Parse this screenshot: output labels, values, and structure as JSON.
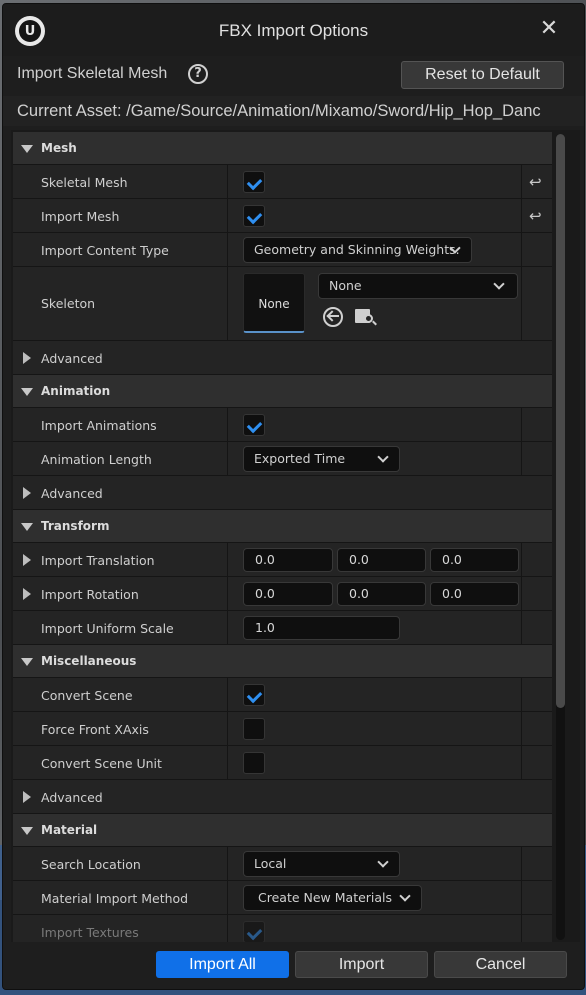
{
  "window": {
    "title": "FBX Import Options"
  },
  "header": {
    "title": "Import Skeletal Mesh",
    "help_icon": "?",
    "reset_label": "Reset to Default"
  },
  "asset": {
    "text": "Current Asset:  /Game/Source/Animation/Mixamo/Sword/Hip_Hop_Danc"
  },
  "sections": {
    "mesh": {
      "label": "Mesh",
      "skeletal_mesh": {
        "label": "Skeletal Mesh",
        "checked": true
      },
      "import_mesh": {
        "label": "Import Mesh",
        "checked": true
      },
      "import_content_type": {
        "label": "Import Content Type",
        "value": "Geometry and Skinning Weights."
      },
      "skeleton": {
        "label": "Skeleton",
        "thumb": "None",
        "value": "None"
      },
      "advanced": "Advanced"
    },
    "animation": {
      "label": "Animation",
      "import_animations": {
        "label": "Import Animations",
        "checked": true
      },
      "animation_length": {
        "label": "Animation Length",
        "value": "Exported Time"
      },
      "advanced": "Advanced"
    },
    "transform": {
      "label": "Transform",
      "import_translation": {
        "label": "Import Translation",
        "x": "0.0",
        "y": "0.0",
        "z": "0.0"
      },
      "import_rotation": {
        "label": "Import Rotation",
        "x": "0.0",
        "y": "0.0",
        "z": "0.0"
      },
      "import_uniform_scale": {
        "label": "Import Uniform Scale",
        "value": "1.0"
      }
    },
    "miscellaneous": {
      "label": "Miscellaneous",
      "convert_scene": {
        "label": "Convert Scene",
        "checked": true
      },
      "force_front_xaxis": {
        "label": "Force Front XAxis",
        "checked": false
      },
      "convert_scene_unit": {
        "label": "Convert Scene Unit",
        "checked": false
      },
      "advanced": "Advanced"
    },
    "material": {
      "label": "Material",
      "search_location": {
        "label": "Search Location",
        "value": "Local"
      },
      "material_import_method": {
        "label": "Material Import Method",
        "value": "Create New Materials"
      },
      "import_textures": {
        "label": "Import Textures",
        "checked": true
      }
    }
  },
  "footer": {
    "import_all": "Import All",
    "import": "Import",
    "cancel": "Cancel"
  },
  "colors": {
    "accent": "#1070e8",
    "check": "#2f8ff0",
    "panel_bg": "#242424",
    "category_bg": "#2f2f2f"
  }
}
